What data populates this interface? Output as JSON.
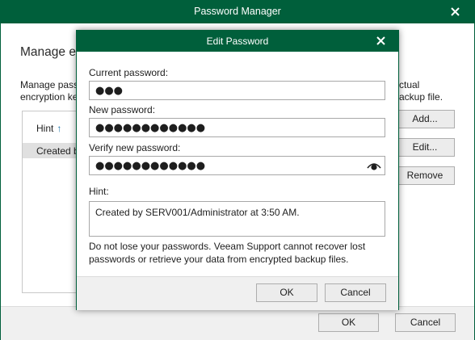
{
  "outer": {
    "title": "Password Manager",
    "heading": "Manage e",
    "desc_left_line1": "Manage pass",
    "desc_left_line2": "encryption ke",
    "desc_right_line1": "ctual",
    "desc_right_line2": "ackup file.",
    "list": {
      "column_header": "Hint",
      "rows": [
        "Created b"
      ]
    },
    "buttons": {
      "add": "Add...",
      "edit": "Edit...",
      "remove": "Remove"
    },
    "footer": {
      "ok": "OK",
      "cancel": "Cancel"
    }
  },
  "modal": {
    "title": "Edit Password",
    "current_password_label": "Current password:",
    "current_password_mask": "●●●",
    "new_password_label": "New password:",
    "new_password_mask": "●●●●●●●●●●●●",
    "verify_password_label": "Verify new password:",
    "verify_password_mask": "●●●●●●●●●●●●",
    "hint_label": "Hint:",
    "hint_value": "Created by SERV001/Administrator at 3:50 AM.",
    "warning": "Do not lose your passwords. Veeam Support cannot recover lost passwords or retrieve your data from encrypted backup files.",
    "footer": {
      "ok": "OK",
      "cancel": "Cancel"
    }
  },
  "icons": {
    "close": "close-icon",
    "sort": "sort-ascending-icon",
    "reveal": "eye-icon"
  },
  "colors": {
    "title_bar": "#005f3b",
    "sort_arrow": "#1a73a8",
    "selected_row": "#e0e0e0",
    "footer_bg": "#f0f0f0"
  }
}
